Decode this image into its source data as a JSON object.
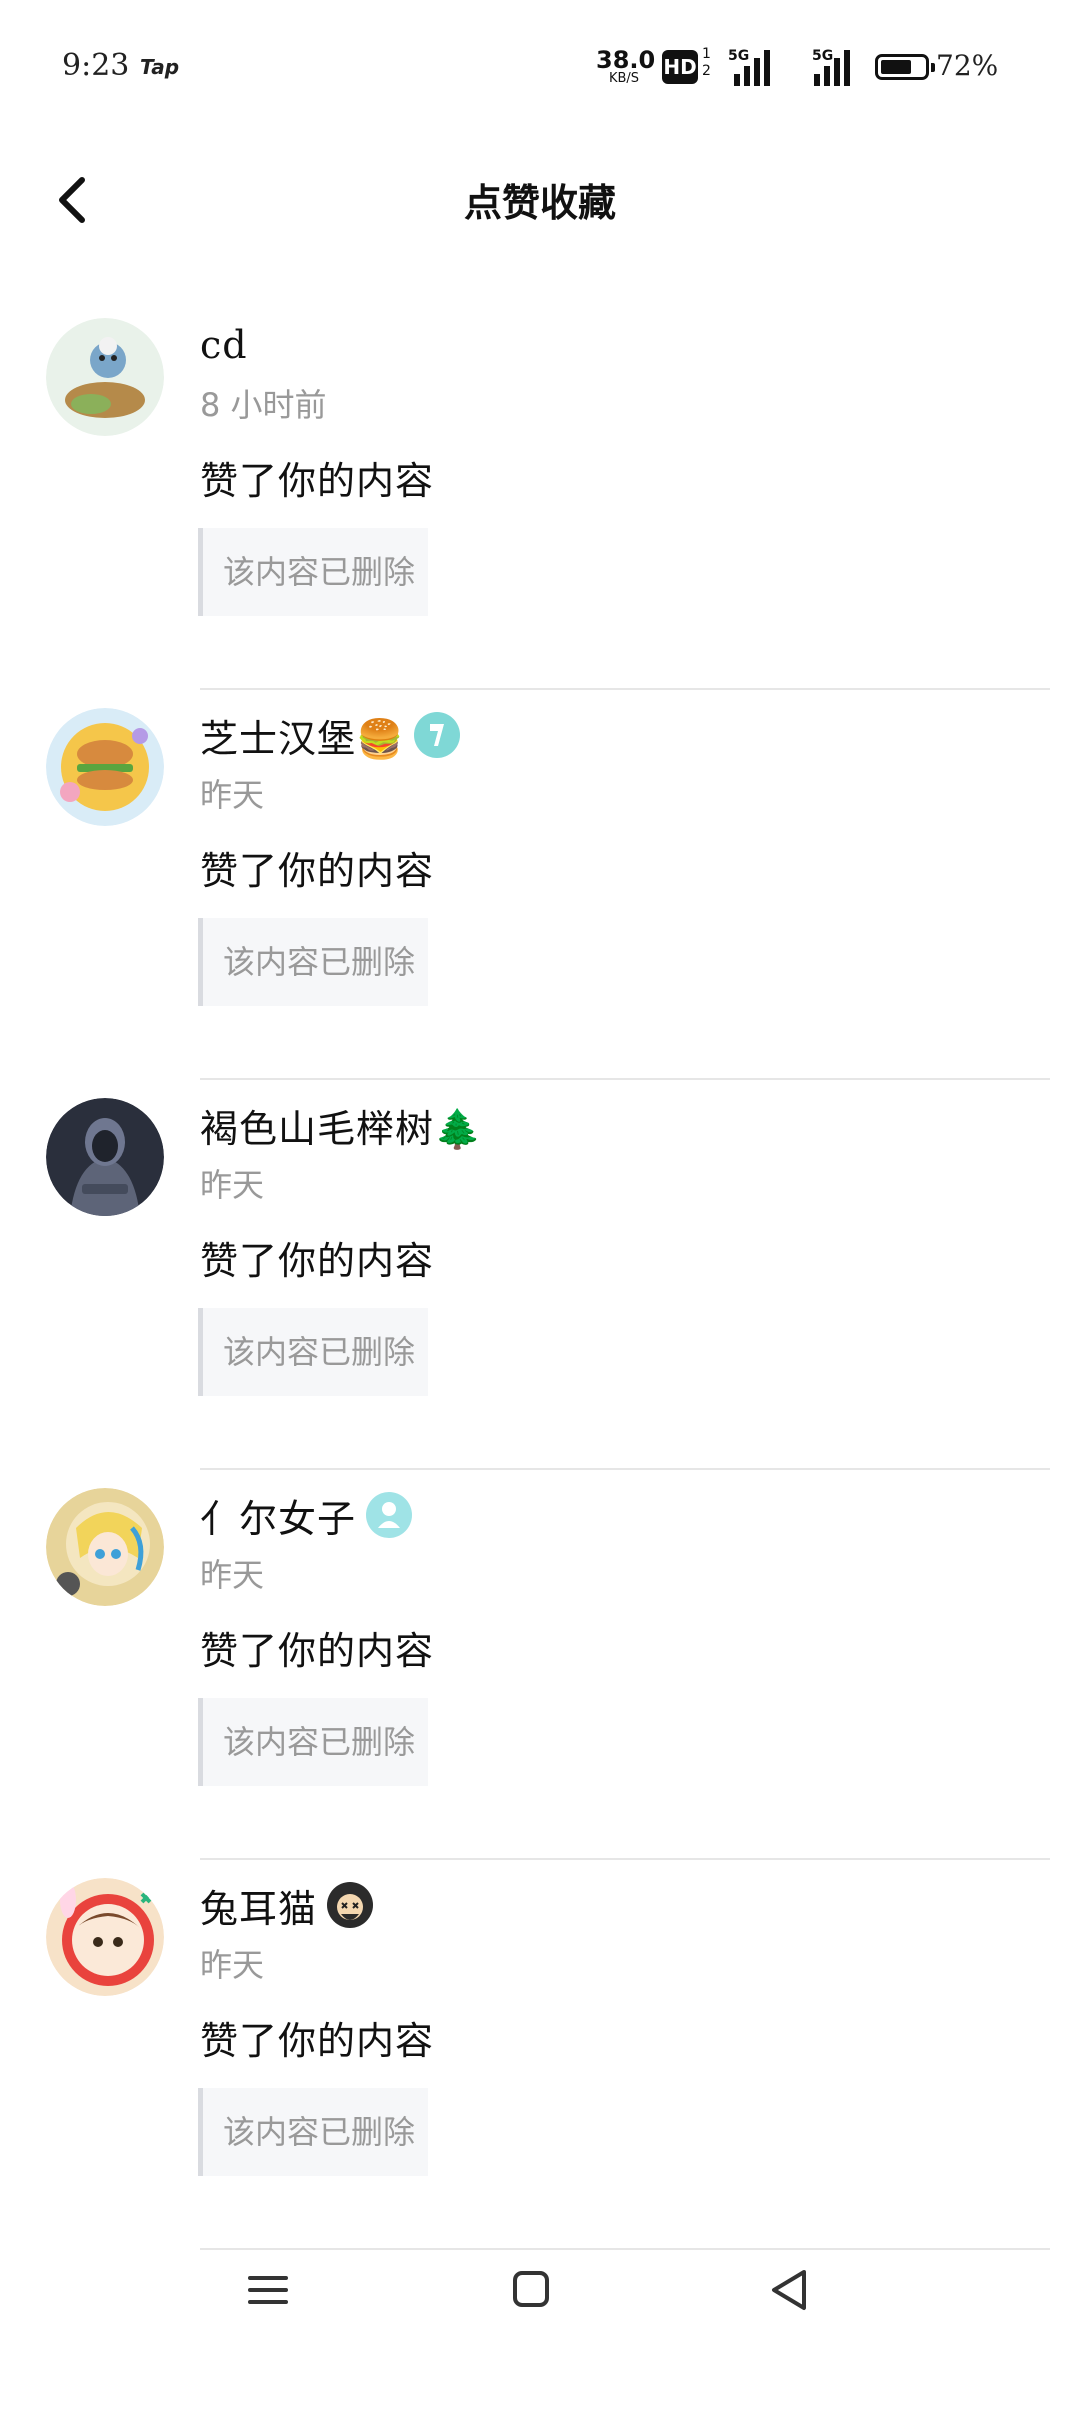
{
  "status_bar": {
    "time": "9:23",
    "app_label": "Tap",
    "net_speed_value": "38.0",
    "net_speed_unit": "KB/S",
    "hd_label": "HD",
    "hd_sub_1": "1",
    "hd_sub_2": "2",
    "sim1_label": "5G",
    "sim2_label": "5G",
    "battery_percent": "72%",
    "battery_level": 0.72
  },
  "header": {
    "title": "点赞收藏",
    "back_icon": "chevron-left-icon"
  },
  "items": [
    {
      "name": "cd",
      "time": "8 小时前",
      "action": "赞了你的内容",
      "quote": "该内容已删除",
      "badge": ""
    },
    {
      "name": "芝士汉堡🍔",
      "time": "昨天",
      "action": "赞了你的内容",
      "quote": "该内容已删除",
      "badge": "teal-level-badge"
    },
    {
      "name": "褐色山毛榉树🌲",
      "time": "昨天",
      "action": "赞了你的内容",
      "quote": "该内容已删除",
      "badge": ""
    },
    {
      "name": "亻尔女子",
      "time": "昨天",
      "action": "赞了你的内容",
      "quote": "该内容已删除",
      "badge": "teal-level-badge"
    },
    {
      "name": "兔耳猫",
      "time": "昨天",
      "action": "赞了你的内容",
      "quote": "该内容已删除",
      "badge": "dark-dizzy-face-badge"
    }
  ],
  "navbar": {
    "menu_icon": "menu-icon",
    "home_icon": "home-square-icon",
    "back_icon": "back-triangle-icon"
  },
  "colors": {
    "text": "#111111",
    "secondary_text": "#999999",
    "quote_bg": "#f6f7f9",
    "quote_bar": "#d9dbe0",
    "divider": "#e6e6e6",
    "badge_teal": "#7fd8d6"
  }
}
